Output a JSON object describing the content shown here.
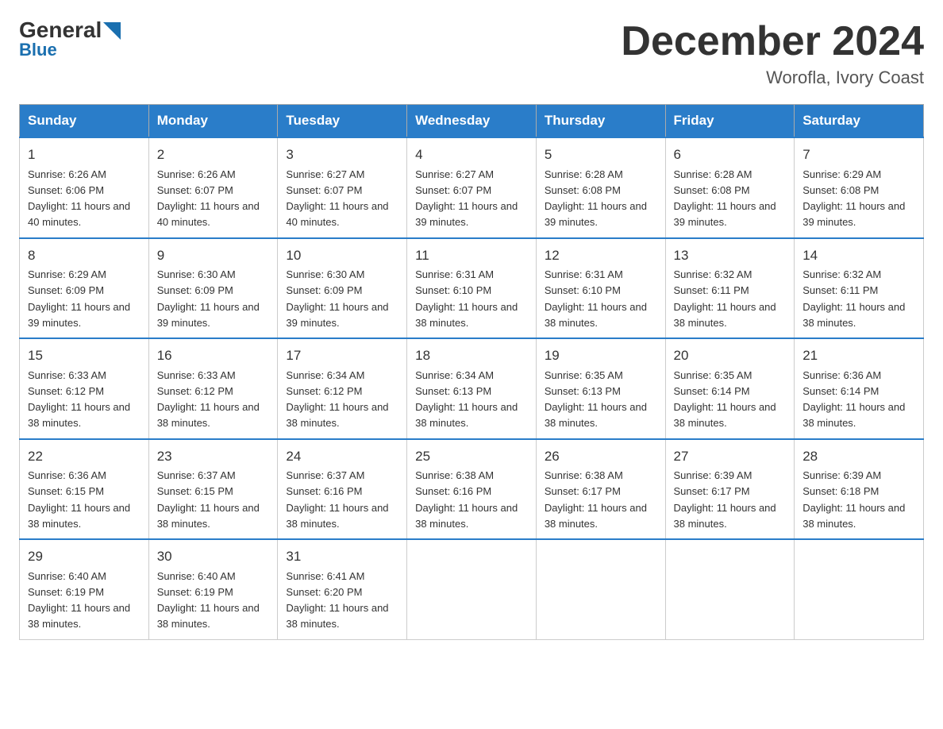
{
  "logo": {
    "general": "General",
    "blue": "Blue"
  },
  "title": "December 2024",
  "subtitle": "Worofla, Ivory Coast",
  "days": [
    "Sunday",
    "Monday",
    "Tuesday",
    "Wednesday",
    "Thursday",
    "Friday",
    "Saturday"
  ],
  "weeks": [
    [
      {
        "num": "1",
        "sunrise": "6:26 AM",
        "sunset": "6:06 PM",
        "daylight": "11 hours and 40 minutes."
      },
      {
        "num": "2",
        "sunrise": "6:26 AM",
        "sunset": "6:07 PM",
        "daylight": "11 hours and 40 minutes."
      },
      {
        "num": "3",
        "sunrise": "6:27 AM",
        "sunset": "6:07 PM",
        "daylight": "11 hours and 40 minutes."
      },
      {
        "num": "4",
        "sunrise": "6:27 AM",
        "sunset": "6:07 PM",
        "daylight": "11 hours and 39 minutes."
      },
      {
        "num": "5",
        "sunrise": "6:28 AM",
        "sunset": "6:08 PM",
        "daylight": "11 hours and 39 minutes."
      },
      {
        "num": "6",
        "sunrise": "6:28 AM",
        "sunset": "6:08 PM",
        "daylight": "11 hours and 39 minutes."
      },
      {
        "num": "7",
        "sunrise": "6:29 AM",
        "sunset": "6:08 PM",
        "daylight": "11 hours and 39 minutes."
      }
    ],
    [
      {
        "num": "8",
        "sunrise": "6:29 AM",
        "sunset": "6:09 PM",
        "daylight": "11 hours and 39 minutes."
      },
      {
        "num": "9",
        "sunrise": "6:30 AM",
        "sunset": "6:09 PM",
        "daylight": "11 hours and 39 minutes."
      },
      {
        "num": "10",
        "sunrise": "6:30 AM",
        "sunset": "6:09 PM",
        "daylight": "11 hours and 39 minutes."
      },
      {
        "num": "11",
        "sunrise": "6:31 AM",
        "sunset": "6:10 PM",
        "daylight": "11 hours and 38 minutes."
      },
      {
        "num": "12",
        "sunrise": "6:31 AM",
        "sunset": "6:10 PM",
        "daylight": "11 hours and 38 minutes."
      },
      {
        "num": "13",
        "sunrise": "6:32 AM",
        "sunset": "6:11 PM",
        "daylight": "11 hours and 38 minutes."
      },
      {
        "num": "14",
        "sunrise": "6:32 AM",
        "sunset": "6:11 PM",
        "daylight": "11 hours and 38 minutes."
      }
    ],
    [
      {
        "num": "15",
        "sunrise": "6:33 AM",
        "sunset": "6:12 PM",
        "daylight": "11 hours and 38 minutes."
      },
      {
        "num": "16",
        "sunrise": "6:33 AM",
        "sunset": "6:12 PM",
        "daylight": "11 hours and 38 minutes."
      },
      {
        "num": "17",
        "sunrise": "6:34 AM",
        "sunset": "6:12 PM",
        "daylight": "11 hours and 38 minutes."
      },
      {
        "num": "18",
        "sunrise": "6:34 AM",
        "sunset": "6:13 PM",
        "daylight": "11 hours and 38 minutes."
      },
      {
        "num": "19",
        "sunrise": "6:35 AM",
        "sunset": "6:13 PM",
        "daylight": "11 hours and 38 minutes."
      },
      {
        "num": "20",
        "sunrise": "6:35 AM",
        "sunset": "6:14 PM",
        "daylight": "11 hours and 38 minutes."
      },
      {
        "num": "21",
        "sunrise": "6:36 AM",
        "sunset": "6:14 PM",
        "daylight": "11 hours and 38 minutes."
      }
    ],
    [
      {
        "num": "22",
        "sunrise": "6:36 AM",
        "sunset": "6:15 PM",
        "daylight": "11 hours and 38 minutes."
      },
      {
        "num": "23",
        "sunrise": "6:37 AM",
        "sunset": "6:15 PM",
        "daylight": "11 hours and 38 minutes."
      },
      {
        "num": "24",
        "sunrise": "6:37 AM",
        "sunset": "6:16 PM",
        "daylight": "11 hours and 38 minutes."
      },
      {
        "num": "25",
        "sunrise": "6:38 AM",
        "sunset": "6:16 PM",
        "daylight": "11 hours and 38 minutes."
      },
      {
        "num": "26",
        "sunrise": "6:38 AM",
        "sunset": "6:17 PM",
        "daylight": "11 hours and 38 minutes."
      },
      {
        "num": "27",
        "sunrise": "6:39 AM",
        "sunset": "6:17 PM",
        "daylight": "11 hours and 38 minutes."
      },
      {
        "num": "28",
        "sunrise": "6:39 AM",
        "sunset": "6:18 PM",
        "daylight": "11 hours and 38 minutes."
      }
    ],
    [
      {
        "num": "29",
        "sunrise": "6:40 AM",
        "sunset": "6:19 PM",
        "daylight": "11 hours and 38 minutes."
      },
      {
        "num": "30",
        "sunrise": "6:40 AM",
        "sunset": "6:19 PM",
        "daylight": "11 hours and 38 minutes."
      },
      {
        "num": "31",
        "sunrise": "6:41 AM",
        "sunset": "6:20 PM",
        "daylight": "11 hours and 38 minutes."
      },
      null,
      null,
      null,
      null
    ]
  ]
}
